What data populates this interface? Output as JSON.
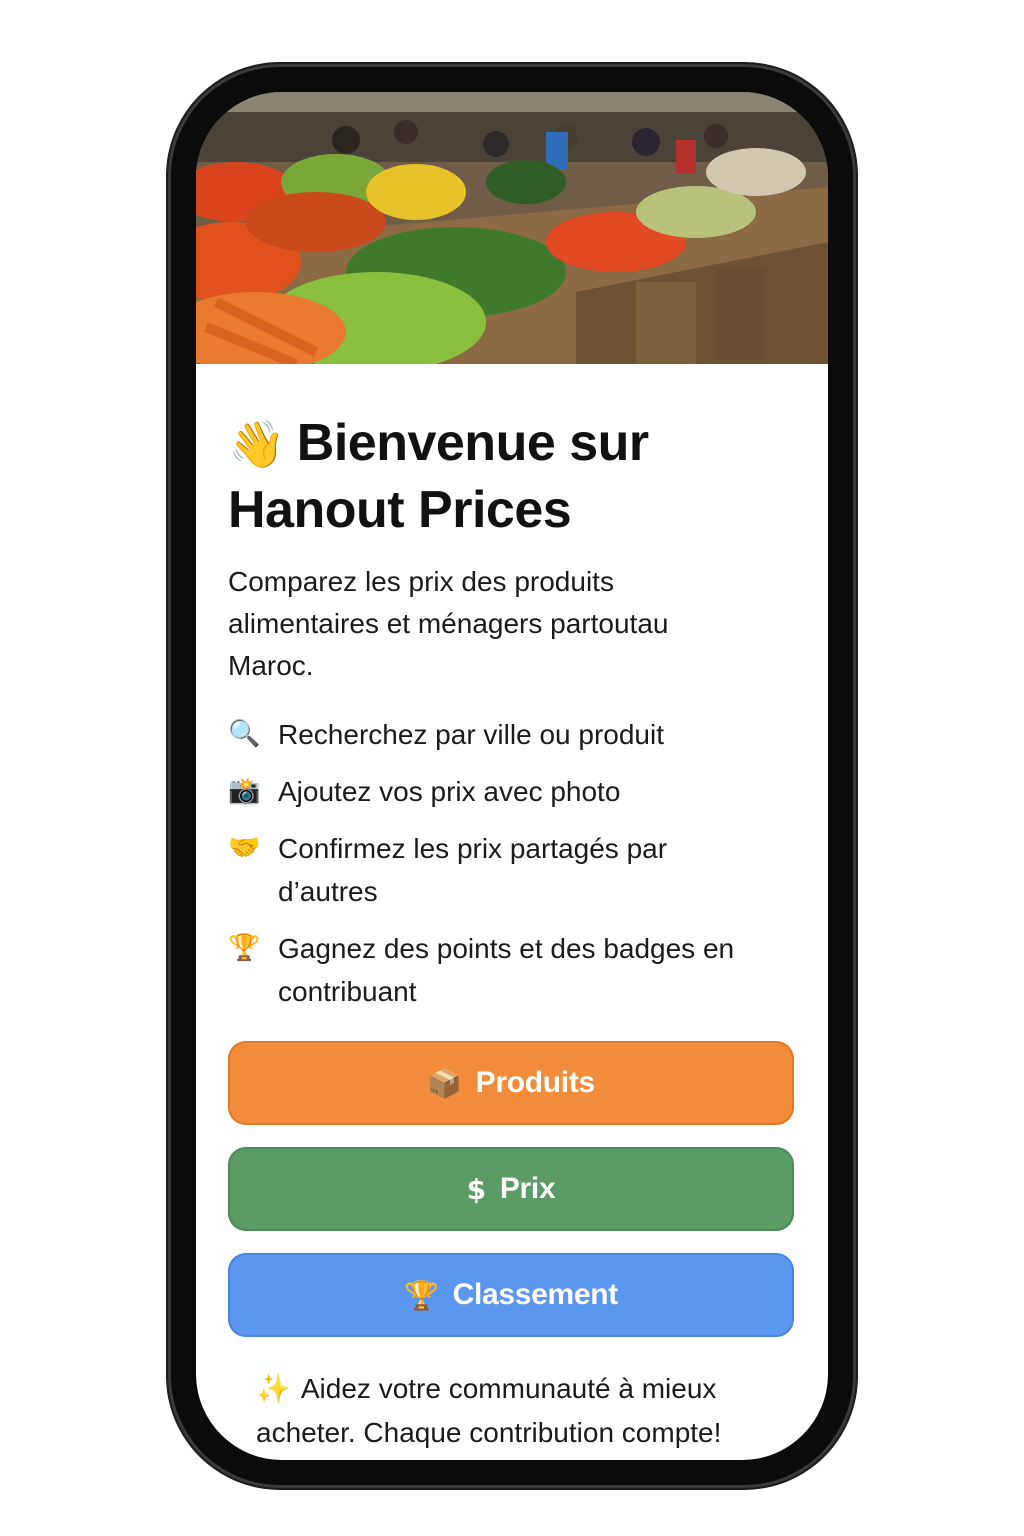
{
  "hero": {
    "image_alt": "market-vegetable-stalls"
  },
  "welcome": {
    "icon": "👋",
    "title_line1": "Bienvenue sur",
    "title_line2": "Hanout Prices",
    "subtitle": "Comparez les prix des produits alimentaires et ménagers partoutau Maroc."
  },
  "features": [
    {
      "icon": "🔍",
      "icon_name": "magnifier-icon",
      "text": "Recherchez par ville ou produit"
    },
    {
      "icon": "📸",
      "icon_name": "camera-icon",
      "text": "Ajoutez vos prix avec photo"
    },
    {
      "icon": "🤝",
      "icon_name": "handshake-icon",
      "text": "Confirmez les prix partagés par d’autres"
    },
    {
      "icon": "🏆",
      "icon_name": "trophy-icon",
      "text": "Gagnez des points et des badges en contribuant"
    }
  ],
  "buttons": {
    "products": {
      "icon": "📦",
      "label": "Produits",
      "color": "#f28b3a"
    },
    "prices": {
      "icon": "$",
      "label": "Prix",
      "color": "#5b9b66"
    },
    "ranking": {
      "icon": "🏆",
      "label": "Classement",
      "color": "#5b97ee"
    }
  },
  "footer": {
    "icon": "✨",
    "text": "Aidez votre communauté à mieux acheter. Chaque contribution compte!"
  }
}
